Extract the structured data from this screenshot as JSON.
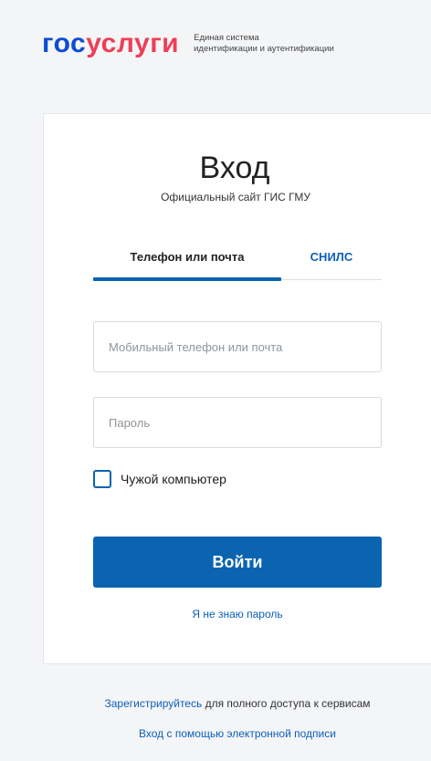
{
  "header": {
    "logo_part1": "гос",
    "logo_part2": "услуги",
    "tagline_line1": "Единая система",
    "tagline_line2": "идентификации и аутентификации"
  },
  "card": {
    "title": "Вход",
    "subtitle": "Официальный сайт ГИС ГМУ",
    "tabs": [
      {
        "label": "Телефон или почта",
        "active": true
      },
      {
        "label": "СНИЛС",
        "active": false
      }
    ],
    "phone_field": {
      "value": "",
      "placeholder": "Мобильный телефон или почта"
    },
    "password_field": {
      "value": "",
      "placeholder": "Пароль"
    },
    "checkbox": {
      "label": "Чужой компьютер",
      "checked": false
    },
    "login_button": "Войти",
    "forgot_link": "Я не знаю пароль"
  },
  "footer": {
    "register_link": "Зарегистрируйтесь",
    "register_text": " для полного доступа к сервисам",
    "signature_link": "Вход с помощью электронной подписи"
  },
  "colors": {
    "brand_blue": "#0d4cd3",
    "brand_red": "#ee3f58",
    "button_blue": "#0a64b0",
    "link_blue": "#0d5fb8"
  }
}
